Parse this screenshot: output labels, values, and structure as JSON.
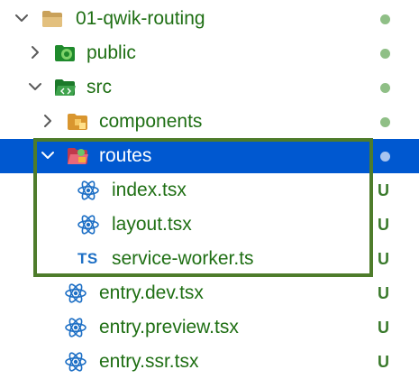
{
  "explorer": {
    "items": [
      {
        "label": "01-qwik-routing",
        "icon": "folder-open-icon",
        "chevron": "chevron-down-icon",
        "status": "dot"
      },
      {
        "label": "public",
        "icon": "folder-public-icon",
        "chevron": "chevron-right-icon",
        "status": "dot"
      },
      {
        "label": "src",
        "icon": "folder-src-open-icon",
        "chevron": "chevron-down-icon",
        "status": "dot"
      },
      {
        "label": "components",
        "icon": "folder-components-icon",
        "chevron": "chevron-right-icon",
        "status": "dot"
      },
      {
        "label": "routes",
        "icon": "folder-routes-open-icon",
        "chevron": "chevron-down-icon",
        "status": "dot",
        "selected": true
      },
      {
        "label": "index.tsx",
        "icon": "react-icon",
        "status": "U"
      },
      {
        "label": "layout.tsx",
        "icon": "react-icon",
        "status": "U"
      },
      {
        "label": "service-worker.ts",
        "icon": "typescript-icon",
        "icon_text": "TS",
        "status": "U"
      },
      {
        "label": "entry.dev.tsx",
        "icon": "react-icon",
        "status": "U"
      },
      {
        "label": "entry.preview.tsx",
        "icon": "react-icon",
        "status": "U"
      },
      {
        "label": "entry.ssr.tsx",
        "icon": "react-icon",
        "status": "U"
      }
    ]
  },
  "colors": {
    "selection": "#0058d0",
    "label_green": "#1f6f14",
    "highlight_border": "#4e7c2b",
    "status_dot": "#8fbf86",
    "untracked": "#3a7a2c",
    "react_blue": "#1d6fc5"
  }
}
